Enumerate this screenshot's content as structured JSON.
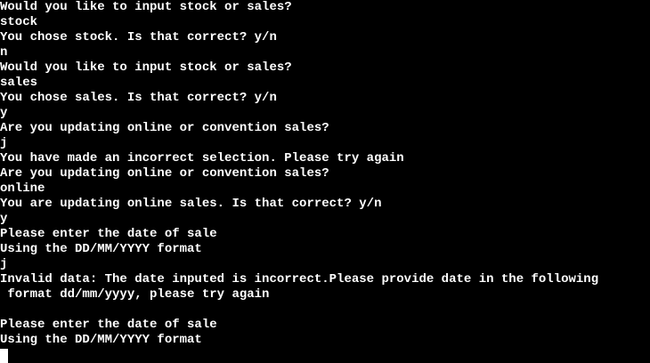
{
  "terminal": {
    "lines": [
      "Would you like to input stock or sales?",
      "stock",
      "You chose stock. Is that correct? y/n",
      "n",
      "Would you like to input stock or sales?",
      "sales",
      "You chose sales. Is that correct? y/n",
      "y",
      "Are you updating online or convention sales?",
      "j",
      "You have made an incorrect selection. Please try again",
      "Are you updating online or convention sales?",
      "online",
      "You are updating online sales. Is that correct? y/n",
      "y",
      "Please enter the date of sale",
      "Using the DD/MM/YYYY format",
      "j",
      "Invalid data: The date inputed is incorrect.Please provide date in the following",
      " format dd/mm/yyyy, please try again",
      "",
      "Please enter the date of sale",
      "Using the DD/MM/YYYY format"
    ]
  },
  "colors": {
    "background": "#000000",
    "text": "#ffffff"
  }
}
